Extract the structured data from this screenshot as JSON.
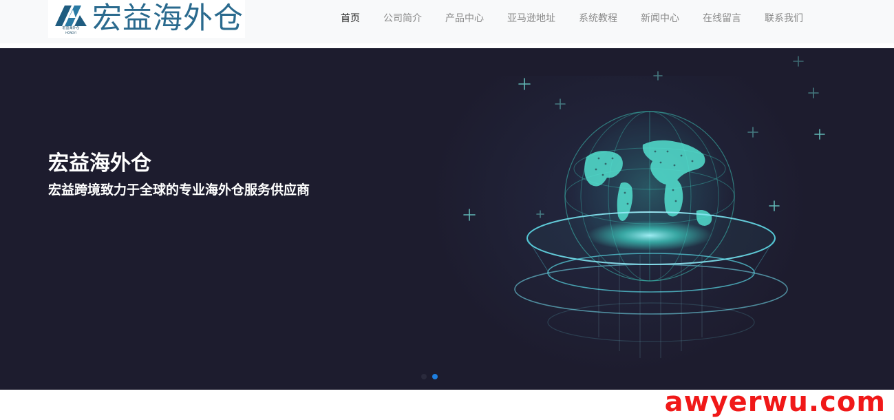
{
  "header": {
    "logo": {
      "text": "宏益海外仓",
      "mark_caption": "宏益海外仓",
      "mark_subcaption": "HONGYI",
      "color": "#2a6a8e"
    },
    "nav": [
      {
        "label": "首页",
        "active": true
      },
      {
        "label": "公司简介",
        "active": false
      },
      {
        "label": "产品中心",
        "active": false
      },
      {
        "label": "亚马逊地址",
        "active": false
      },
      {
        "label": "系统教程",
        "active": false
      },
      {
        "label": "新闻中心",
        "active": false
      },
      {
        "label": "在线留言",
        "active": false
      },
      {
        "label": "联系我们",
        "active": false
      }
    ]
  },
  "hero": {
    "title": "宏益海外仓",
    "subtitle": "宏益跨境致力于全球的专业海外仓服务供应商",
    "background_color": "#1d1c2e",
    "accent_color": "#3fd3c4",
    "slides": [
      {
        "active": false
      },
      {
        "active": true
      }
    ]
  },
  "watermark": {
    "text": "awyerwu.com",
    "color": "#f01818"
  }
}
